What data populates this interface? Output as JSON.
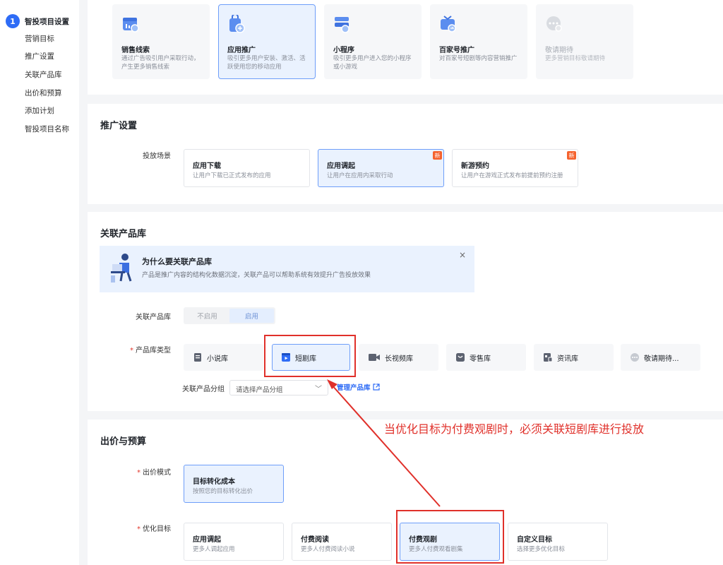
{
  "sidebar": {
    "step_number": "1",
    "step_label": "智投项目设置",
    "items": [
      {
        "label": "营销目标"
      },
      {
        "label": "推广设置"
      },
      {
        "label": "关联产品库"
      },
      {
        "label": "出价和预算"
      },
      {
        "label": "添加计划"
      },
      {
        "label": "智投项目名称"
      }
    ]
  },
  "marketing_goals": [
    {
      "title": "销售线索",
      "desc": "通过广告吸引用户采取行动，产生更多销售线索",
      "icon": "sales-lead-icon"
    },
    {
      "title": "应用推广",
      "desc": "吸引更多用户安装、激活、活跃使用您的移动应用",
      "icon": "app-promotion-icon",
      "selected": true
    },
    {
      "title": "小程序",
      "desc": "吸引更多用户进入您的小程序或小游戏",
      "icon": "mini-program-icon"
    },
    {
      "title": "百家号推广",
      "desc": "对百家号短剧等内容营销推广",
      "icon": "baijiahao-icon"
    },
    {
      "title": "敬请期待",
      "desc": "更多营销目标敬请期待",
      "icon": "more-icon",
      "disabled": true
    }
  ],
  "promo_settings": {
    "title": "推广设置",
    "scene_label": "投放场景",
    "scenes": [
      {
        "title": "应用下载",
        "desc": "让用户下载已正式发布的应用"
      },
      {
        "title": "应用调起",
        "desc": "让用户在应用内采取行动",
        "badge": "新",
        "selected": true
      },
      {
        "title": "新游预约",
        "desc": "让用户在游戏正式发布前提前预约注册",
        "badge": "新"
      }
    ]
  },
  "product_library": {
    "title": "关联产品库",
    "info_title": "为什么要关联产品库",
    "info_desc": "产品是推广内容的结构化数据沉淀，关联产品可以帮助系统有效提升广告投放效果",
    "close_glyph": "×",
    "link_label": "关联产品库",
    "toggle_off": "不启用",
    "toggle_on": "启用",
    "required_mark": "*",
    "type_label": "产品库类型",
    "types": [
      {
        "label": "小说库",
        "icon": "novel-icon"
      },
      {
        "label": "短剧库",
        "icon": "short-drama-icon",
        "selected": true
      },
      {
        "label": "长视频库",
        "icon": "long-video-icon"
      },
      {
        "label": "零售库",
        "icon": "retail-icon"
      },
      {
        "label": "资讯库",
        "icon": "news-icon"
      },
      {
        "label": "敬请期待...",
        "icon": "more-icon"
      }
    ],
    "group_label": "关联产品分组",
    "group_placeholder": "请选择产品分组",
    "chevron_glyph": "﹀",
    "manage_label": "管理产品库"
  },
  "bidding": {
    "title": "出价与预算",
    "required_mark": "*",
    "mode_label": "出价模式",
    "mode": {
      "title": "目标转化成本",
      "desc": "按照您的目标转化出价"
    },
    "goal_label": "优化目标",
    "goals": [
      {
        "title": "应用调起",
        "desc": "更多人调起应用"
      },
      {
        "title": "付费阅读",
        "desc": "更多人付费阅读小说"
      },
      {
        "title": "付费观剧",
        "desc": "更多人付费观看剧集",
        "selected": true
      },
      {
        "title": "自定义目标",
        "desc": "选择更多优化目标"
      }
    ]
  },
  "annotation": {
    "text": "当优化目标为付费观剧时，必须关联短剧库进行投放",
    "color": "#e0302a"
  },
  "colors": {
    "accent": "#2e6cf6",
    "selected_bg": "#eaf2fe",
    "selected_border": "#6e9ef9"
  }
}
